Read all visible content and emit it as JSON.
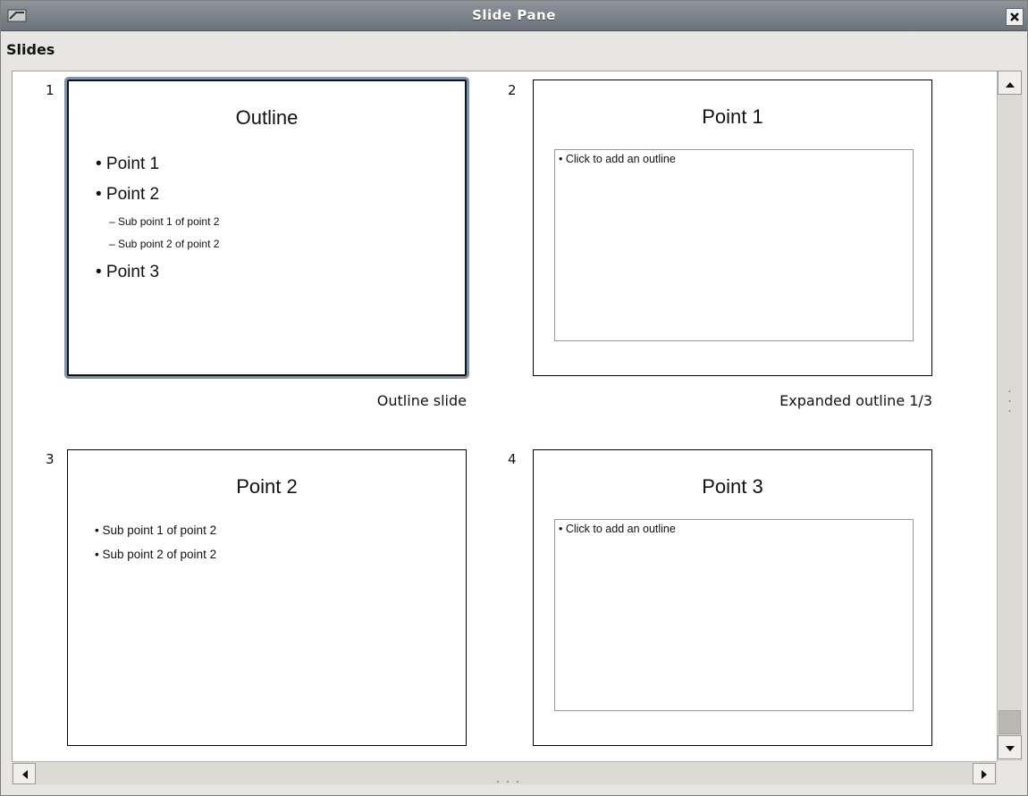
{
  "window": {
    "title": "Slide Pane"
  },
  "pane": {
    "label": "Slides"
  },
  "slides": [
    {
      "number": "1",
      "title": "Outline",
      "caption": "Outline slide",
      "selected": true,
      "bullets": [
        "• Point 1",
        "• Point 2",
        "• Point 3"
      ],
      "sub_bullets": [
        "– Sub point 1 of point 2",
        "– Sub point 2 of point 2"
      ]
    },
    {
      "number": "2",
      "title": "Point 1",
      "caption": "Expanded outline 1/3",
      "placeholder": "• Click to add an outline"
    },
    {
      "number": "3",
      "title": "Point 2",
      "caption": "",
      "bullets": [
        "• Sub point 1 of point 2",
        "• Sub point 2 of point 2"
      ]
    },
    {
      "number": "4",
      "title": "Point 3",
      "caption": "",
      "placeholder": "• Click to add an outline"
    }
  ],
  "icons": {
    "window_icon": "app-window-icon",
    "close": "close-icon",
    "scroll_up": "arrow-up-icon",
    "scroll_down": "arrow-down-icon",
    "scroll_left": "arrow-left-icon",
    "scroll_right": "arrow-right-icon"
  },
  "colors": {
    "selection_accent": "#7b91ad",
    "titlebar": "#7a828b"
  }
}
